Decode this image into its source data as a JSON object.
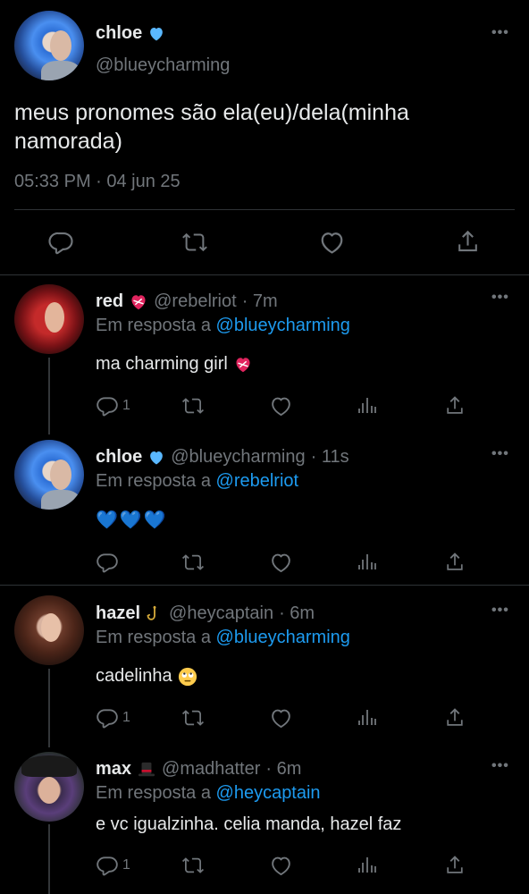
{
  "main_tweet": {
    "name": "chloe",
    "handle": "@blueycharming",
    "text": "meus pronomes são ela(eu)/dela(minha namorada)",
    "timestamp": "05:33 PM · 04 jun 25"
  },
  "replies": [
    {
      "name": "red",
      "handle": "@rebelriot",
      "time": "· 7m",
      "reply_prefix": "Em resposta a",
      "reply_to": "@blueycharming",
      "text": "ma charming girl",
      "reply_count": "1"
    },
    {
      "name": "chloe",
      "handle": "@blueycharming",
      "time": "· 11s",
      "reply_prefix": "Em resposta a",
      "reply_to": "@rebelriot",
      "text": "💙💙💙",
      "reply_count": ""
    },
    {
      "name": "hazel",
      "handle": "@heycaptain",
      "time": "· 6m",
      "reply_prefix": "Em resposta a",
      "reply_to": "@blueycharming",
      "text": "cadelinha",
      "reply_count": "1"
    },
    {
      "name": "max",
      "handle": "@madhatter",
      "time": "· 6m",
      "reply_prefix": "Em resposta a",
      "reply_to": "@heycaptain",
      "text": "e vc igualzinha. celia manda, hazel faz",
      "reply_count": "1"
    }
  ],
  "icons": {
    "verified": "blue-heart-icon",
    "reply": "reply-icon",
    "retweet": "retweet-icon",
    "like": "like-icon",
    "views": "views-icon",
    "share": "share-icon",
    "more": "more-icon"
  },
  "colors": {
    "background": "#000000",
    "text": "#e7e9ea",
    "muted": "#71767b",
    "link": "#1d9bf0",
    "blue_heart": "#5ab8ff"
  }
}
